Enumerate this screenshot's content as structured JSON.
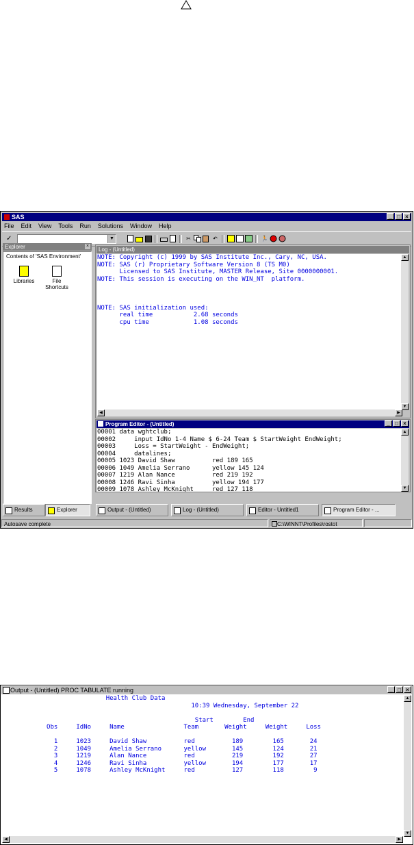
{
  "main_window": {
    "title": "SAS",
    "menu": [
      "File",
      "Edit",
      "View",
      "Tools",
      "Run",
      "Solutions",
      "Window",
      "Help"
    ],
    "explorer": {
      "title": "Explorer",
      "contents_label": "Contents of 'SAS Environment'",
      "items": [
        {
          "label": "Libraries"
        },
        {
          "label": "File Shortcuts"
        }
      ]
    },
    "log": {
      "title": "Log - (Untitled)",
      "lines": [
        "NOTE: Copyright (c) 1999 by SAS Institute Inc., Cary, NC, USA.",
        "NOTE: SAS (r) Proprietary Software Version 8 (TS M0)",
        "      Licensed to SAS Institute, MASTER Release, Site 0000000001.",
        "NOTE: This session is executing on the WIN_NT  platform.",
        "",
        "",
        "",
        "NOTE: SAS initialization used:",
        "      real time           2.68 seconds",
        "      cpu time            1.08 seconds"
      ]
    },
    "program_editor": {
      "title": "Program Editor - (Untitled)",
      "lines": [
        "00001 data wghtclub;",
        "00002     input IdNo 1-4 Name $ 6-24 Team $ StartWeight EndWeight;",
        "00003     Loss = StartWeight - EndWeight;",
        "00004     datalines;",
        "00005 1023 David Shaw          red 189 165",
        "00006 1049 Amelia Serrano      yellow 145 124",
        "00007 1219 Alan Nance          red 219 192",
        "00008 1246 Ravi Sinha          yellow 194 177",
        "00009 1078 Ashley McKnight     red 127 118"
      ]
    },
    "tabs_left": [
      "Results",
      "Explorer"
    ],
    "tabs_right": [
      "Output - (Untitled)",
      "Log - (Untitled)",
      "Editor - Untitled1",
      "Program Editor - ..."
    ],
    "status": {
      "message": "Autosave complete",
      "path": "C:\\WINNT\\Profiles\\rostot"
    }
  },
  "output_window": {
    "title": "Output - (Untitled)   PROC TABULATE running",
    "lines": [
      "                            Health Club Data",
      "                                                   10:39 Wednesday, September 22",
      "",
      "                                                    Start        End",
      "            Obs     IdNo     Name                Team       Weight     Weight     Loss",
      "",
      "              1     1023     David Shaw          red          189        165       24",
      "              2     1049     Amelia Serrano      yellow       145        124       21",
      "              3     1219     Alan Nance          red          219        192       27",
      "              4     1246     Ravi Sinha          yellow       194        177       17",
      "              5     1078     Ashley McKnight     red          127        118        9"
    ]
  }
}
